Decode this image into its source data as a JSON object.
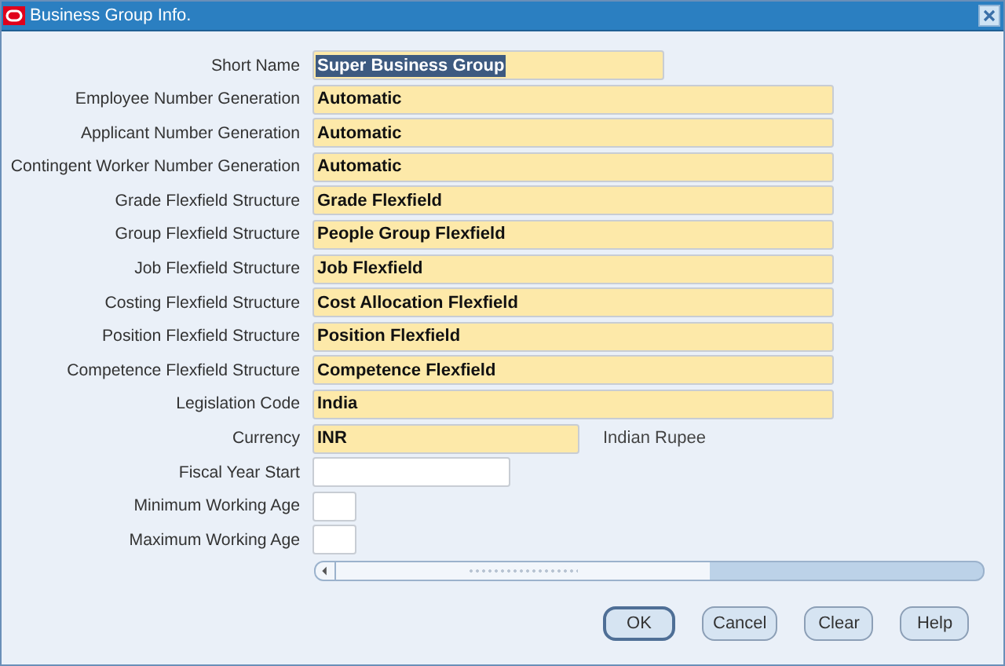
{
  "window": {
    "title": "Business Group Info."
  },
  "fields": [
    {
      "label": "Short Name",
      "value": "Super Business Group",
      "kind": "name",
      "required": true,
      "selected": true
    },
    {
      "label": "Employee Number Generation",
      "value": "Automatic",
      "kind": "wide",
      "required": true,
      "selected": false
    },
    {
      "label": "Applicant Number Generation",
      "value": "Automatic",
      "kind": "wide",
      "required": true,
      "selected": false
    },
    {
      "label": "Contingent Worker Number Generation",
      "value": "Automatic",
      "kind": "wide",
      "required": true,
      "selected": false
    },
    {
      "label": "Grade Flexfield Structure",
      "value": "Grade Flexfield",
      "kind": "wide",
      "required": true,
      "selected": false
    },
    {
      "label": "Group Flexfield Structure",
      "value": "People Group Flexfield",
      "kind": "wide",
      "required": true,
      "selected": false
    },
    {
      "label": "Job Flexfield Structure",
      "value": "Job Flexfield",
      "kind": "wide",
      "required": true,
      "selected": false
    },
    {
      "label": "Costing Flexfield Structure",
      "value": "Cost Allocation Flexfield",
      "kind": "wide",
      "required": true,
      "selected": false
    },
    {
      "label": "Position Flexfield Structure",
      "value": "Position Flexfield",
      "kind": "wide",
      "required": true,
      "selected": false
    },
    {
      "label": "Competence Flexfield Structure",
      "value": "Competence Flexfield",
      "kind": "wide",
      "required": true,
      "selected": false
    },
    {
      "label": "Legislation Code",
      "value": "India",
      "kind": "wide",
      "required": true,
      "selected": false
    },
    {
      "label": "Currency",
      "value": "INR",
      "kind": "medium",
      "required": true,
      "selected": false,
      "description": "Indian Rupee"
    },
    {
      "label": "Fiscal Year Start",
      "kind": "date",
      "required": false
    },
    {
      "label": "Minimum Working Age",
      "kind": "tiny",
      "required": false
    },
    {
      "label": "Maximum Working Age",
      "kind": "tiny",
      "required": false
    }
  ],
  "buttons": [
    {
      "label": "OK",
      "default": true
    },
    {
      "label": "Cancel",
      "default": false
    },
    {
      "label": "Clear",
      "default": false
    },
    {
      "label": "Help",
      "default": false
    }
  ]
}
